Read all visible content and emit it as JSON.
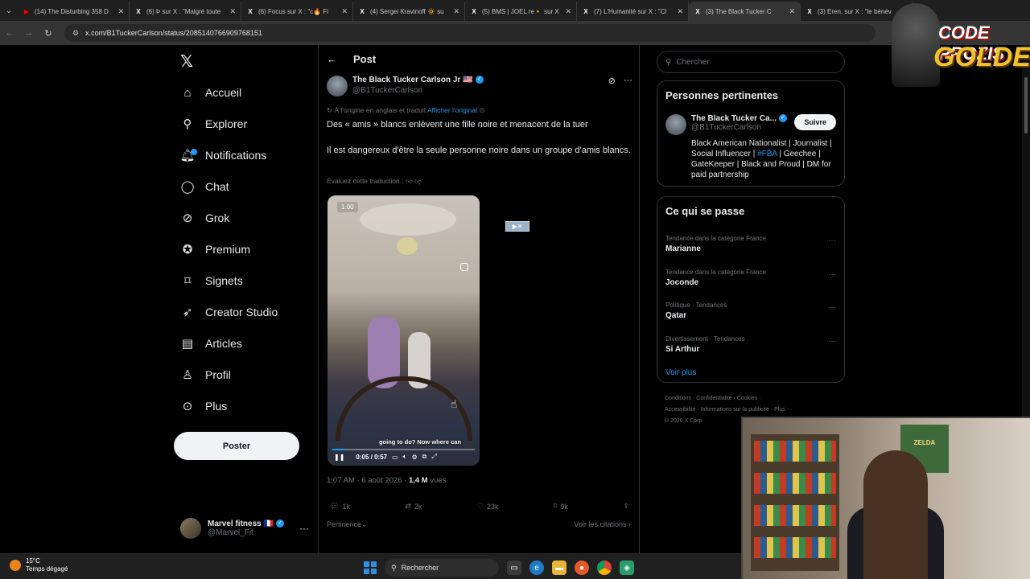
{
  "browser": {
    "tabs": [
      {
        "title": "(14) The Disturbing 358 D",
        "favicon_color": "#ff0000",
        "favicon": "▶"
      },
      {
        "title": "(6) Þ sur X : \"Malgré toute",
        "favicon_color": "#ffffff",
        "favicon": "X"
      },
      {
        "title": "(6) Focus sur X : \"c🔥 Fi",
        "favicon_color": "#ffffff",
        "favicon": "X"
      },
      {
        "title": "(4) Sergei Kravinoff 🔅 su",
        "favicon_color": "#ffffff",
        "favicon": "X"
      },
      {
        "title": "(5) BMS | JOEL re🔸 sur X",
        "favicon_color": "#ffffff",
        "favicon": "X"
      },
      {
        "title": "(7) L'Humanité sur X : \"Cl",
        "favicon_color": "#ffffff",
        "favicon": "X"
      },
      {
        "title": "(3) The Black Tucker C",
        "favicon_color": "#ffffff",
        "favicon": "X",
        "active": true
      },
      {
        "title": "(3) Eren. sur X : \"le bénév",
        "favicon_color": "#ffffff",
        "favicon": "X"
      }
    ],
    "url": "x.com/B1TuckerCarlson/status/2085140766909768151"
  },
  "nav": {
    "items": [
      {
        "label": "Accueil",
        "icon": "home-icon"
      },
      {
        "label": "Explorer",
        "icon": "search-icon"
      },
      {
        "label": "Notifications",
        "icon": "bell-icon"
      },
      {
        "label": "Chat",
        "icon": "chat-icon"
      },
      {
        "label": "Grok",
        "icon": "grok-icon"
      },
      {
        "label": "Premium",
        "icon": "premium-icon"
      },
      {
        "label": "Signets",
        "icon": "bookmark-icon"
      },
      {
        "label": "Creator Studio",
        "icon": "rocket-icon"
      },
      {
        "label": "Articles",
        "icon": "article-icon"
      },
      {
        "label": "Profil",
        "icon": "person-icon"
      },
      {
        "label": "Plus",
        "icon": "more-circle-icon"
      }
    ],
    "post_button": "Poster",
    "account": {
      "name": "Marvel fitness 🇫🇷",
      "handle": "@Marvel_Fit"
    }
  },
  "post": {
    "header_title": "Post",
    "author_name": "The Black Tucker Carlson Jr 🇺🇸",
    "author_handle": "@B1TuckerCarlson",
    "translation_note": "À l'origine en anglais et traduit",
    "show_original": "Afficher l'original",
    "text_line1": "Des « amis » blancs enlèvent une fille noire et menacent de la tuer",
    "text_line2": "Il est dangereux d'être la seule personne noire dans un groupe d'amis blancs.",
    "rate_translation": "Évaluez cette traduction :",
    "video": {
      "speed": "1.00",
      "subtitle": "going to do? Now where can",
      "time": "0:05 / 0:57",
      "progress": 0.088
    },
    "time": "1:07 AM · 6 août 2026 · ",
    "views": "1,4 M",
    "views_label": " vues",
    "stats": {
      "replies": "1k",
      "reposts": "2k",
      "likes": "23k",
      "bookmarks": "9k"
    },
    "relevance": "Pertinence",
    "quotes": "Voir les citations"
  },
  "right": {
    "search_placeholder": "Chercher",
    "relevant_title": "Personnes pertinentes",
    "relevant_person": {
      "name": "The Black Tucker Ca...",
      "handle": "@B1TuckerCarlson",
      "follow": "Suivre",
      "bio_before": "Black American Nationalist | Journalist | Social Influencer | ",
      "bio_tag": "#FBA",
      "bio_after": " | Geechee | GateKeeper | Black and Proud | DM for paid partnership"
    },
    "trends_title": "Ce qui se passe",
    "trends": [
      {
        "category": "Tendance dans la catégorie France",
        "name": "Marianne"
      },
      {
        "category": "Tendance dans la catégorie France",
        "name": "Joconde"
      },
      {
        "category": "Politique · Tendances",
        "name": "Qatar"
      },
      {
        "category": "Divertissement · Tendances",
        "name": "Si Arthur"
      }
    ],
    "see_more": "Voir plus",
    "footer_line1": "Conditions  ·  Confidentialité  ·  Cookies  ·",
    "footer_line2": "Accessibilité  ·  Informations sur la publicité  ·  Plus ···",
    "footer_line3": "© 2026 X Corp."
  },
  "overlay": {
    "logo_line1": "CODE PROZIS",
    "logo_line2": "GOLDENG",
    "poster_text": "ZELDA"
  },
  "taskbar": {
    "temp": "15°C",
    "weather": "Temps dégagé",
    "search": "Rechercher"
  }
}
